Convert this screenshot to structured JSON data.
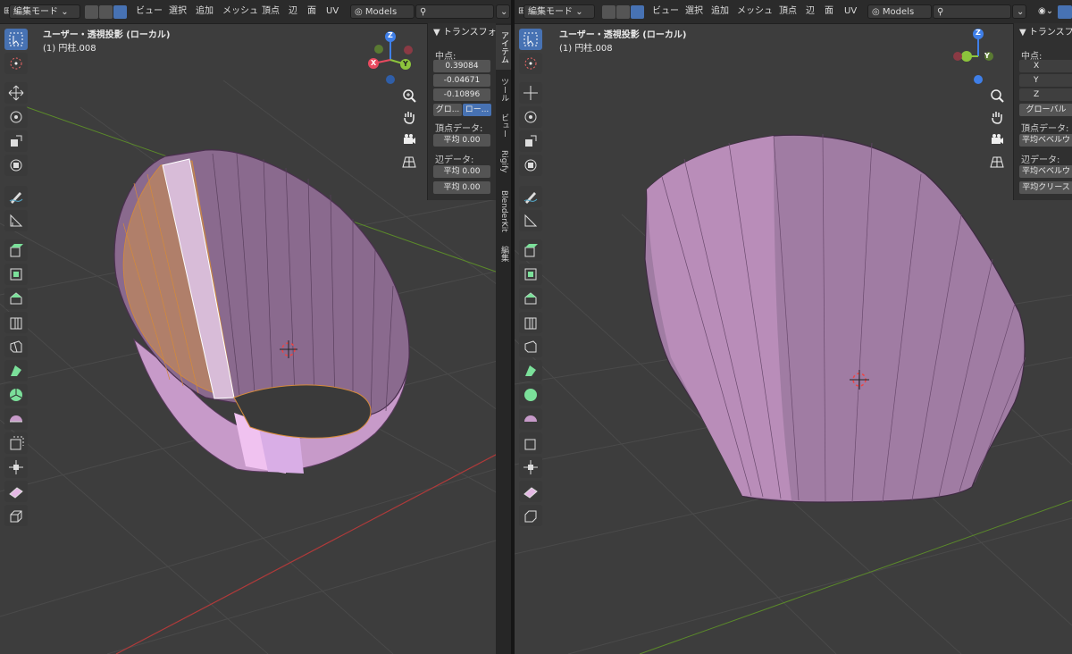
{
  "colors": {
    "viewport_bg": "#3d3d3d",
    "header_bg": "#2b2b2b",
    "accent": "#4772b3",
    "mesh_face": "#b485b8",
    "selected_edge": "#ffa030",
    "axis_x": "#e84a5f",
    "axis_y": "#8cc43c",
    "axis_z": "#3f7fe8",
    "grid_line": "#4a4a4a"
  },
  "left": {
    "header": {
      "mode": "編集モード",
      "menus": [
        "ビュー",
        "選択",
        "追加",
        "メッシュ",
        "頂点",
        "辺",
        "面",
        "UV"
      ],
      "collection": "Models",
      "search_icon": "search-icon"
    },
    "viewport": {
      "title": "ユーザー・透視投影 (ローカル)",
      "object": "(1) 円柱.008"
    },
    "gizmo": {
      "x": "X",
      "y": "Y",
      "z": "Z"
    },
    "npanel": {
      "title": "▼ トランスフォ",
      "median_label": "中点:",
      "values": [
        "0.39084",
        "-0.04671",
        "-0.10896"
      ],
      "space_global": "グロ...",
      "space_local": "ロー...",
      "vertex_data_label": "頂点データ:",
      "vertex_bevel": "平均  0.00",
      "edge_data_label": "辺データ:",
      "edge_bevel": "平均  0.00",
      "edge_crease": "平均  0.00"
    },
    "tabs": [
      "アイテム",
      "ツール",
      "ビュー",
      "Rigify",
      "BlenderKit",
      "編集"
    ]
  },
  "right": {
    "header": {
      "mode": "編集モード",
      "menus": [
        "ビュー",
        "選択",
        "追加",
        "メッシュ",
        "頂点",
        "辺",
        "面",
        "UV"
      ],
      "collection": "Models"
    },
    "viewport": {
      "title": "ユーザー・透視投影 (ローカル)",
      "object": "(1) 円柱.008"
    },
    "gizmo": {
      "z": "Z",
      "y": "Y"
    },
    "npanel": {
      "title": "▼ トランスフォ",
      "median_label": "中点:",
      "fields": [
        "X",
        "Y",
        "Z"
      ],
      "space_global": "グローバル",
      "vertex_data_label": "頂点データ:",
      "vertex_bevel": "平均ベベルウ",
      "edge_data_label": "辺データ:",
      "edge_bevel": "平均ベベルウ",
      "edge_crease": "平均クリース"
    }
  }
}
